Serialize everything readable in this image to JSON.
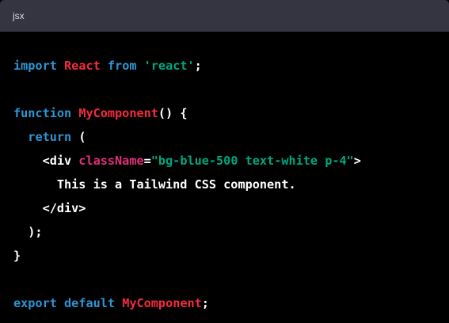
{
  "header": {
    "language": "jsx"
  },
  "colors": {
    "keyword": "#2e95d3",
    "identifier": "#f22c3d",
    "string": "#00a67d",
    "attribute": "#df3079",
    "plain": "#ffffff",
    "header_bg": "#343541",
    "code_bg": "#000000"
  },
  "code": {
    "line1": {
      "t1": "import",
      "t2": " ",
      "t3": "React",
      "t4": " ",
      "t5": "from",
      "t6": " ",
      "t7": "'react'",
      "t8": ";"
    },
    "line3": {
      "t1": "function",
      "t2": " ",
      "t3": "MyComponent",
      "t4": "() {"
    },
    "line4": {
      "t1": "  ",
      "t2": "return",
      "t3": " ("
    },
    "line5": {
      "t1": "    <div ",
      "t2": "className",
      "t3": "=",
      "t4": "\"bg-blue-500 text-white p-4\"",
      "t5": ">"
    },
    "line6": {
      "t1": "      This is a Tailwind CSS component."
    },
    "line7": {
      "t1": "    </div>"
    },
    "line8": {
      "t1": "  );"
    },
    "line9": {
      "t1": "}"
    },
    "line11": {
      "t1": "export",
      "t2": " ",
      "t3": "default",
      "t4": " ",
      "t5": "MyComponent",
      "t6": ";"
    }
  }
}
